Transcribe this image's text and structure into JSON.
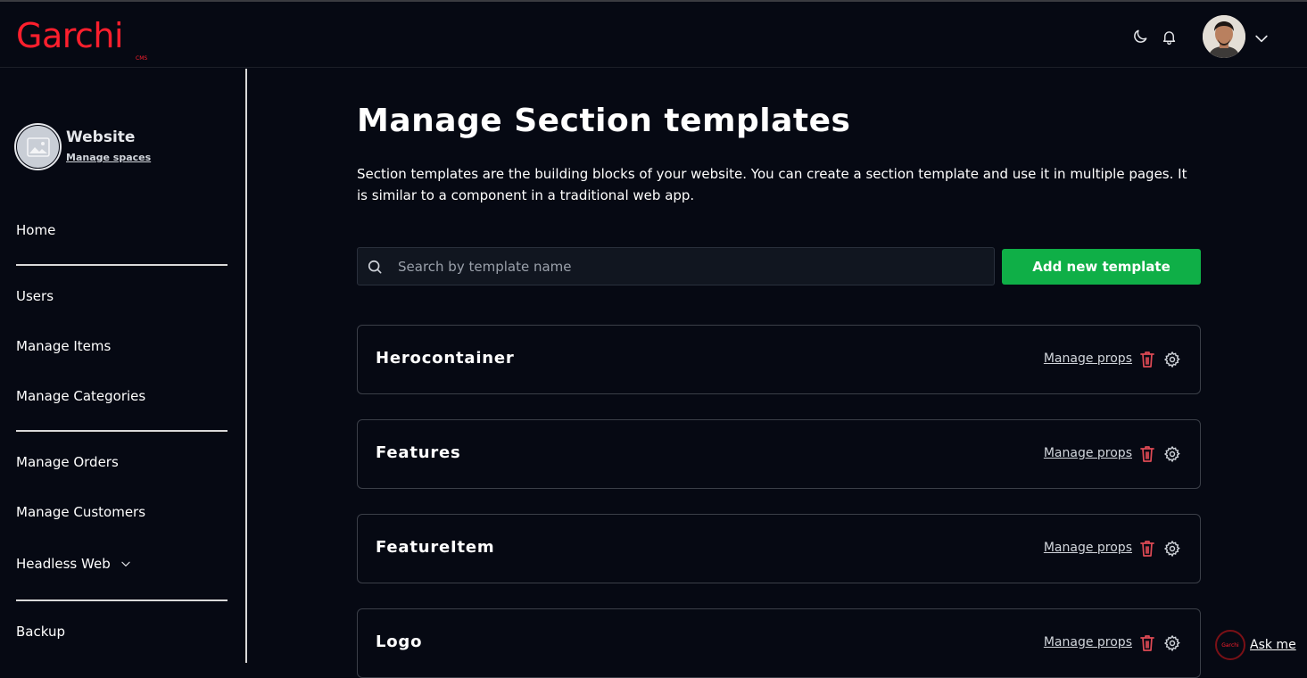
{
  "header": {
    "logo_text": "Garchi",
    "logo_sub": "CMS",
    "theme_toggle_icon": "moon-icon",
    "notifications_icon": "bell-icon",
    "user_menu_icon": "chevron-down-icon"
  },
  "sidebar": {
    "space": {
      "name": "Website",
      "manage_link": "Manage spaces"
    },
    "items": [
      {
        "label": "Home"
      },
      {
        "label": "Users"
      },
      {
        "label": "Manage Items"
      },
      {
        "label": "Manage Categories"
      },
      {
        "label": "Manage Orders"
      },
      {
        "label": "Manage Customers"
      },
      {
        "label": "Headless Web"
      },
      {
        "label": "Backup"
      }
    ]
  },
  "main": {
    "title": "Manage Section templates",
    "description": "Section templates are the building blocks of your website. You can create a section template and use it in multiple pages. It is similar to a component in a traditional web app.",
    "search": {
      "placeholder": "Search by template name",
      "value": ""
    },
    "add_button_label": "Add new template",
    "templates": [
      {
        "name": "Herocontainer",
        "action_label": "Manage props"
      },
      {
        "name": "Features",
        "action_label": "Manage props"
      },
      {
        "name": "FeatureItem",
        "action_label": "Manage props"
      },
      {
        "name": "Logo",
        "action_label": "Manage props"
      }
    ]
  },
  "assistant": {
    "logo_text": "Garchi",
    "label": "Ask me"
  },
  "colors": {
    "background": "#060913",
    "brand": "#ff1f2d",
    "primary_button": "#0faf47",
    "danger_icon": "#e04a55"
  }
}
